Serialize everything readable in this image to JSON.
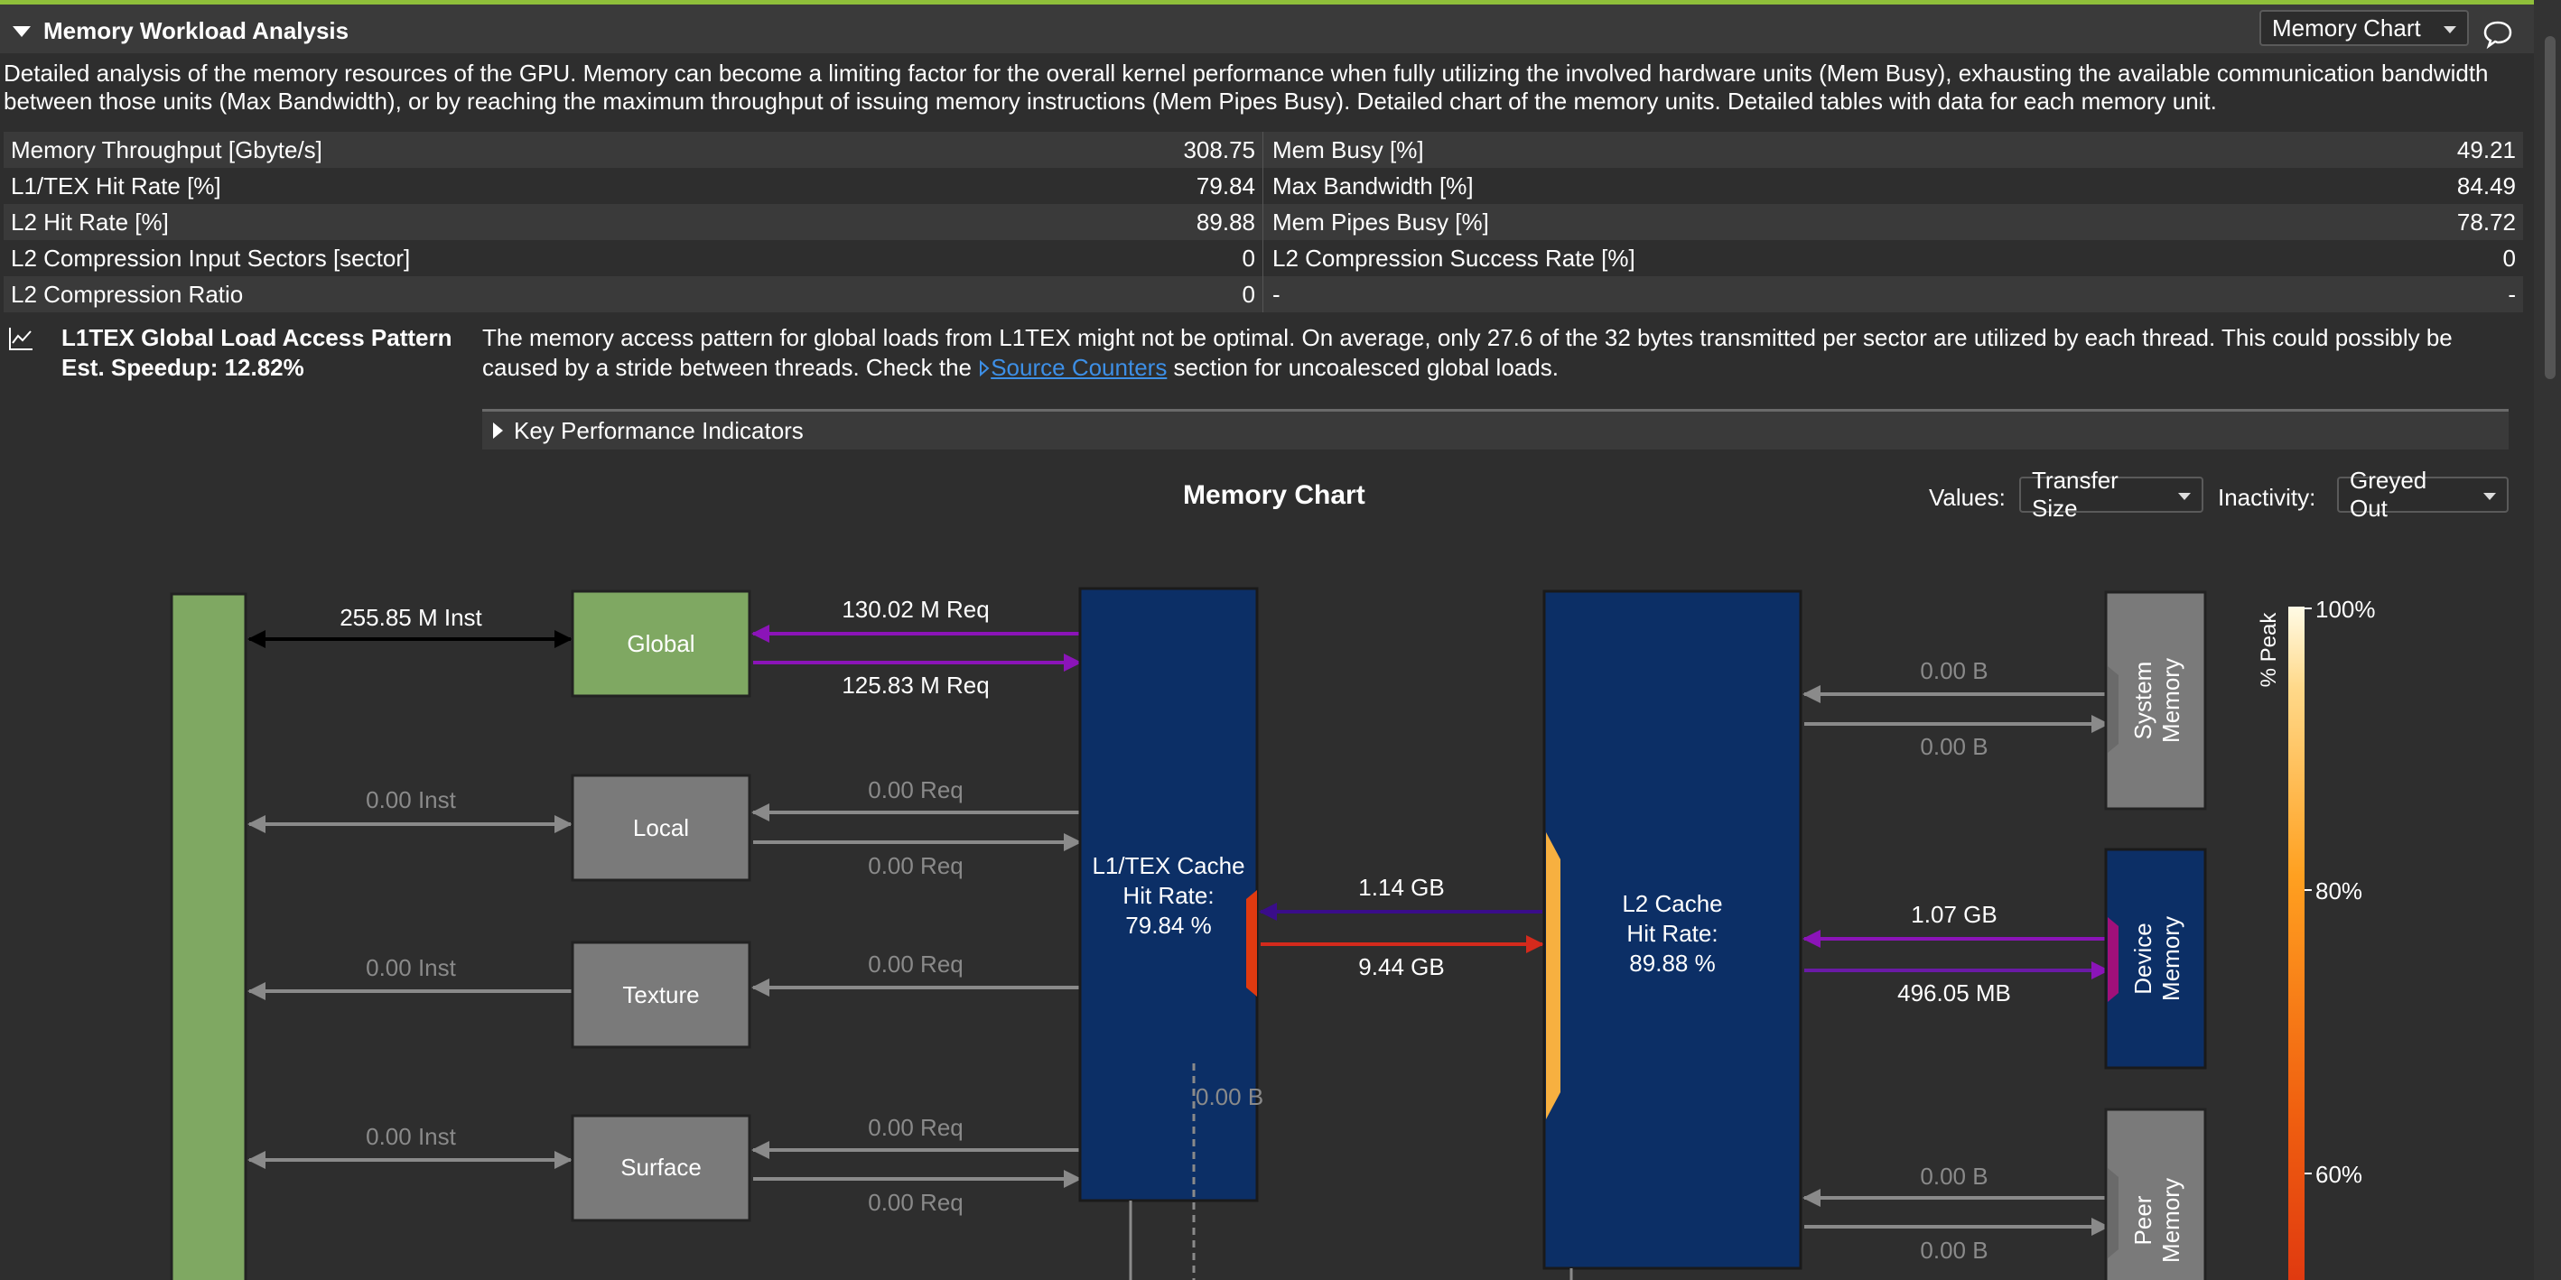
{
  "section": {
    "title": "Memory Workload Analysis",
    "view_select": "Memory Chart",
    "description": "Detailed analysis of the memory resources of the GPU. Memory can become a limiting factor for the overall kernel performance when fully utilizing the involved hardware units (Mem Busy), exhausting the available communication bandwidth between those units (Max Bandwidth), or by reaching the maximum throughput of issuing memory instructions (Mem Pipes Busy). Detailed chart of the memory units. Detailed tables with data for each memory unit."
  },
  "metrics": [
    {
      "l_label": "Memory Throughput [Gbyte/s]",
      "l_value": "308.75",
      "r_label": "Mem Busy [%]",
      "r_value": "49.21"
    },
    {
      "l_label": "L1/TEX Hit Rate [%]",
      "l_value": "79.84",
      "r_label": "Max Bandwidth [%]",
      "r_value": "84.49"
    },
    {
      "l_label": "L2 Hit Rate [%]",
      "l_value": "89.88",
      "r_label": "Mem Pipes Busy [%]",
      "r_value": "78.72"
    },
    {
      "l_label": "L2 Compression Input Sectors [sector]",
      "l_value": "0",
      "r_label": "L2 Compression Success Rate [%]",
      "r_value": "0"
    },
    {
      "l_label": "L2 Compression Ratio",
      "l_value": "0",
      "r_label": "-",
      "r_value": "-"
    }
  ],
  "rule": {
    "title": "L1TEX Global Load Access Pattern",
    "speedup": "Est. Speedup: 12.82%",
    "text_before": "The memory access pattern for global loads from L1TEX might not be optimal. On average, only 27.6 of the 32 bytes transmitted per sector are utilized by each thread. This could possibly be caused by a stride between threads. Check the ",
    "link": "Source Counters",
    "text_after": " section for uncoalesced global loads."
  },
  "kpi": {
    "label": "Key Performance Indicators"
  },
  "chart": {
    "title": "Memory Chart",
    "values_label": "Values:",
    "values_select": "Transfer Size",
    "inactivity_label": "Inactivity:",
    "inactivity_select": "Greyed Out",
    "nodes": {
      "global": "Global",
      "local": "Local",
      "texture": "Texture",
      "surface": "Surface",
      "l1_name": "L1/TEX Cache",
      "l1_hit": "Hit Rate:",
      "l1_val": "79.84 %",
      "l2_name": "L2 Cache",
      "l2_hit": "Hit Rate:",
      "l2_val": "89.88 %",
      "system": "System Memory",
      "device": "Device Memory",
      "peer": "Peer Memory"
    },
    "links": {
      "kernel_global": "255.85 M Inst",
      "global_req_in": "130.02 M Req",
      "global_req_out": "125.83 M Req",
      "kernel_local": "0.00 Inst",
      "local_req_in": "0.00 Req",
      "local_req_out": "0.00 Req",
      "kernel_texture": "0.00 Inst",
      "texture_req": "0.00 Req",
      "kernel_surface": "0.00 Inst",
      "surface_req_in": "0.00 Req",
      "surface_req_out": "0.00 Req",
      "l1_l2_in": "1.14 GB",
      "l1_l2_out": "9.44 GB",
      "l1_shared": "0.00 B",
      "system_in": "0.00 B",
      "system_out": "0.00 B",
      "device_in": "1.07 GB",
      "device_out": "496.05 MB",
      "peer_in": "0.00 B",
      "peer_out": "0.00 B"
    },
    "legend": {
      "title": "% Peak",
      "ticks": [
        "100%",
        "80%",
        "60%"
      ]
    },
    "colors": {
      "global_link": "#8b14b8",
      "l1_l2_out": "#d42a1c",
      "l1_l2_in": "#3a0d8a",
      "device_link": "#8b14b8",
      "inactive": "#8a8a8a",
      "l1_box": "#0c2f66",
      "kernel_box": "#7fa862"
    }
  }
}
